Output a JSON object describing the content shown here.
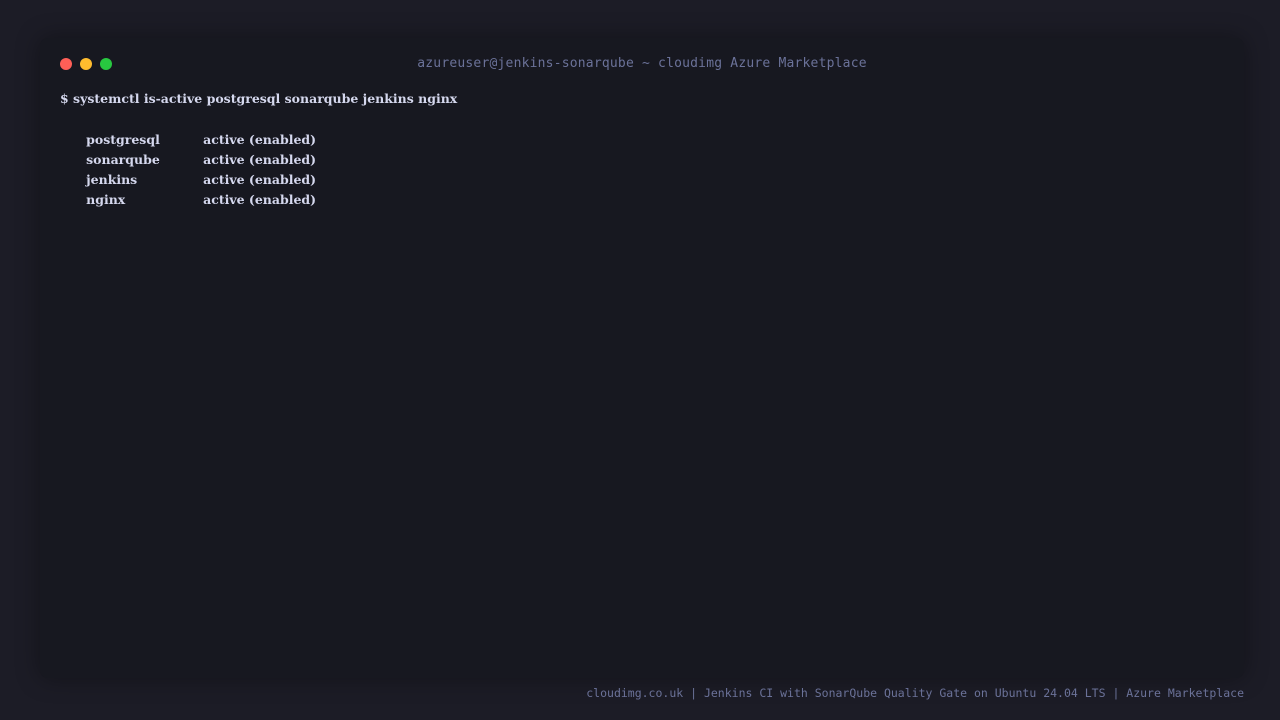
{
  "window": {
    "title": "azureuser@jenkins-sonarqube ~ cloudimg Azure Marketplace",
    "controls": {
      "close_color": "#ff5f57",
      "minimize_color": "#febc2e",
      "maximize_color": "#28c840"
    }
  },
  "terminal": {
    "command": "$ systemctl is-active postgresql sonarqube jenkins nginx",
    "services": [
      {
        "name": "postgresql",
        "status": "active (enabled)"
      },
      {
        "name": "sonarqube",
        "status": "active (enabled)"
      },
      {
        "name": "jenkins",
        "status": "active (enabled)"
      },
      {
        "name": "nginx",
        "status": "active (enabled)"
      }
    ]
  },
  "footer": {
    "text": "cloudimg.co.uk | Jenkins CI with SonarQube Quality Gate on Ubuntu 24.04 LTS | Azure Marketplace"
  },
  "colors": {
    "background": "#1c1c26",
    "terminal_bg": "#171820",
    "text": "#d5d8ee",
    "muted": "#6b7299"
  }
}
